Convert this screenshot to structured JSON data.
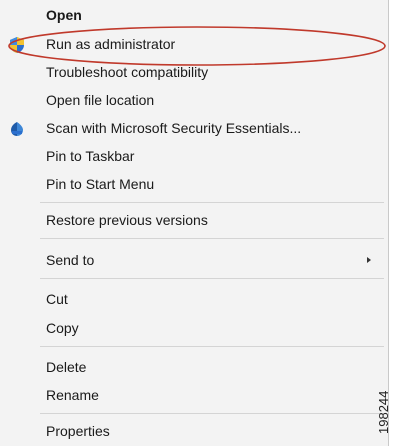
{
  "context_menu": {
    "items": {
      "open": "Open",
      "run_as_administrator": "Run as administrator",
      "troubleshoot_compatibility": "Troubleshoot compatibility",
      "open_file_location": "Open file location",
      "scan_security_essentials": "Scan with Microsoft Security Essentials...",
      "pin_to_taskbar": "Pin to Taskbar",
      "pin_to_start_menu": "Pin to Start Menu",
      "restore_previous_versions": "Restore previous versions",
      "send_to": "Send to",
      "cut": "Cut",
      "copy": "Copy",
      "delete": "Delete",
      "rename": "Rename",
      "properties": "Properties"
    },
    "icons": {
      "run_as_administrator": "uac-shield-icon",
      "scan_security_essentials": "security-essentials-icon",
      "send_to": "submenu-arrow-icon"
    },
    "highlight_color": "#c0392b"
  },
  "figure_id": "198244"
}
